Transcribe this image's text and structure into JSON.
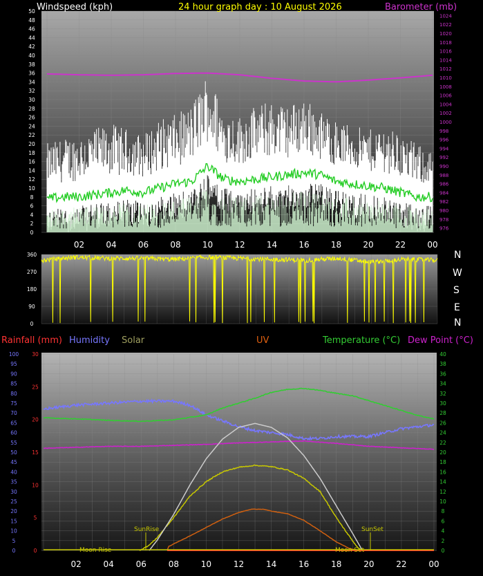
{
  "header": {
    "left": "Windspeed (kph)",
    "center": "24 hour graph day : 10 August 2026",
    "right": "Barometer (mb)"
  },
  "compass": [
    "N",
    "W",
    "S",
    "E",
    "N"
  ],
  "legend": {
    "rainfall": "Rainfall (mm)",
    "humidity": "Humidity",
    "solar": "Solar",
    "uv": "UV",
    "temperature": "Temperature (°C)",
    "dew_point": "Dew Point (°C)"
  },
  "colors": {
    "windspeed": "#ffffff",
    "gust_fill": "#ccf0cc",
    "wind_avg": "#22cc22",
    "barometer": "#cc33cc",
    "direction": "#ffff00",
    "rainfall": "#ff3333",
    "humidity": "#7777ff",
    "solar": "#c8c800",
    "solar_max": "#cccccc",
    "uv": "#d06010",
    "temperature": "#33cc33",
    "dew_point": "#cc22cc",
    "sunrise_label": "#c8c800",
    "moon_label": "#c8c800"
  },
  "annotations": {
    "sunrise": "SunRise",
    "sunset": "SunSet",
    "moon_rise": "Moon Rise",
    "moon_set": "Moon Set"
  },
  "chart_data": [
    {
      "type": "line",
      "title": "24 hour graph day : 10 August 2026",
      "x_unit": "hour of day",
      "x_ticks": [
        "02",
        "04",
        "06",
        "08",
        "10",
        "12",
        "14",
        "16",
        "18",
        "20",
        "22",
        "00"
      ],
      "grid": true,
      "axes": {
        "windspeed": {
          "label": "Windspeed (kph)",
          "range": [
            0,
            50
          ],
          "ticks": [
            0,
            2,
            4,
            6,
            8,
            10,
            12,
            14,
            16,
            18,
            20,
            22,
            24,
            26,
            28,
            30,
            32,
            34,
            36,
            38,
            40,
            42,
            44,
            46,
            48,
            50
          ]
        },
        "barometer": {
          "label": "Barometer (mb)",
          "range": [
            975,
            1025
          ],
          "ticks": [
            976,
            978,
            980,
            982,
            984,
            986,
            988,
            990,
            992,
            994,
            996,
            998,
            1000,
            1002,
            1004,
            1006,
            1008,
            1010,
            1012,
            1014,
            1016,
            1018,
            1020,
            1022,
            1024
          ]
        }
      },
      "series": [
        {
          "name": "Barometer (mb)",
          "axis": "barometer",
          "x": [
            0,
            2,
            4,
            6,
            8,
            10,
            12,
            14,
            16,
            18,
            20,
            22,
            24
          ],
          "values": [
            1010.8,
            1010.6,
            1010.5,
            1010.6,
            1010.9,
            1011.0,
            1010.6,
            1009.8,
            1009.2,
            1009.0,
            1009.4,
            1009.9,
            1010.5
          ]
        },
        {
          "name": "Wind average (kph)",
          "axis": "windspeed",
          "x": [
            0,
            1,
            2,
            3,
            4,
            5,
            6,
            7,
            8,
            9,
            10,
            11,
            12,
            13,
            14,
            15,
            16,
            17,
            18,
            19,
            20,
            21,
            22,
            23,
            24
          ],
          "values": [
            7.5,
            8,
            8,
            8.5,
            9,
            9.5,
            9,
            10,
            11,
            11.5,
            15,
            12,
            11.5,
            12,
            12.5,
            13,
            13.5,
            13,
            11.5,
            11,
            10.5,
            10,
            9,
            8,
            8
          ]
        },
        {
          "name": "Wind gust (kph)",
          "axis": "windspeed",
          "x": [
            0,
            1,
            2,
            3,
            4,
            5,
            6,
            7,
            8,
            9,
            10,
            11,
            12,
            13,
            14,
            15,
            16,
            17,
            18,
            19,
            20,
            21,
            22,
            23,
            24
          ],
          "values": [
            18,
            19,
            20,
            21,
            22,
            21,
            20,
            23,
            24,
            26,
            33,
            25,
            24,
            26,
            27,
            26,
            28,
            25,
            23,
            22,
            21,
            22,
            20,
            18,
            17
          ]
        }
      ]
    },
    {
      "type": "scatter",
      "title": "Wind direction",
      "x_unit": "hour of day",
      "y_range": [
        0,
        360
      ],
      "y_ticks": [
        0,
        90,
        180,
        270,
        360
      ],
      "series": [
        {
          "name": "Direction (deg)",
          "x": [
            0,
            2,
            4,
            6,
            8,
            10,
            12,
            14,
            16,
            18,
            20,
            22,
            24
          ],
          "values": [
            330,
            345,
            340,
            340,
            335,
            345,
            340,
            335,
            330,
            340,
            320,
            335,
            330
          ]
        }
      ]
    },
    {
      "type": "line",
      "title": "",
      "x_unit": "hour of day",
      "x_ticks": [
        "02",
        "04",
        "06",
        "08",
        "10",
        "12",
        "14",
        "16",
        "18",
        "20",
        "22",
        "00"
      ],
      "grid": true,
      "axes": {
        "humidity": {
          "label": "Humidity",
          "range": [
            0,
            100
          ],
          "ticks": [
            0,
            5,
            10,
            15,
            20,
            25,
            30,
            35,
            40,
            45,
            50,
            55,
            60,
            65,
            70,
            75,
            80,
            85,
            90,
            95,
            100
          ]
        },
        "rain_uv": {
          "label": "Rainfall (mm)",
          "range": [
            0,
            30
          ],
          "ticks": [
            0,
            5,
            10,
            15,
            20,
            25,
            30
          ]
        },
        "temperature": {
          "label": "Temperature (°C)",
          "range": [
            0,
            40
          ],
          "ticks": [
            0,
            2,
            4,
            6,
            8,
            10,
            12,
            14,
            16,
            18,
            20,
            22,
            24,
            26,
            28,
            30,
            32,
            34,
            36,
            38,
            40
          ]
        }
      },
      "series": [
        {
          "name": "Humidity",
          "axis": "humidity",
          "x": [
            0,
            2,
            4,
            6,
            8,
            9,
            10,
            11,
            12,
            13,
            14,
            15,
            16,
            17,
            18,
            19,
            20,
            21,
            22,
            23,
            24
          ],
          "values": [
            72,
            74,
            75,
            76,
            76,
            74,
            69,
            66,
            63,
            61,
            60,
            59,
            57,
            57,
            58,
            58,
            58,
            60,
            62,
            63,
            64
          ]
        },
        {
          "name": "Temperature (°C)",
          "axis": "temperature",
          "x": [
            0,
            2,
            4,
            6,
            8,
            10,
            11,
            12,
            13,
            14,
            15,
            16,
            17,
            18,
            19,
            20,
            21,
            22,
            23,
            24
          ],
          "values": [
            27,
            26.8,
            26.5,
            26.3,
            26.6,
            27.6,
            29,
            30,
            31,
            32.2,
            32.8,
            33,
            32.6,
            32,
            31.5,
            30.5,
            29.5,
            28.5,
            27.5,
            26.8
          ]
        },
        {
          "name": "Dew Point (°C)",
          "axis": "temperature",
          "x": [
            0,
            2,
            4,
            6,
            8,
            10,
            12,
            14,
            16,
            18,
            20,
            22,
            24
          ],
          "values": [
            20.8,
            21,
            21.2,
            21.2,
            21.4,
            21.6,
            21.9,
            22.1,
            22.3,
            21.8,
            21.2,
            20.9,
            20.6
          ]
        },
        {
          "name": "Solar",
          "axis": "rain_uv",
          "x": [
            5.9,
            6.5,
            7,
            8,
            9,
            10,
            11,
            12,
            13,
            14,
            15,
            16,
            17,
            18,
            18.7,
            19.2,
            19.5
          ],
          "values": [
            0,
            0.8,
            2,
            5,
            8.3,
            10.5,
            12,
            12.7,
            13,
            12.8,
            12.3,
            11,
            9,
            5,
            2.5,
            0.8,
            0
          ]
        },
        {
          "name": "Solar max",
          "axis": "rain_uv",
          "x": [
            6.5,
            7,
            8,
            9,
            10,
            11,
            12,
            13,
            14,
            15,
            16,
            17,
            18,
            19,
            19.6
          ],
          "values": [
            0,
            1.6,
            5.5,
            10,
            14,
            17,
            18.8,
            19.4,
            18.8,
            17.2,
            14.5,
            11,
            6.8,
            2.6,
            0
          ]
        },
        {
          "name": "UV",
          "axis": "rain_uv",
          "x": [
            7.6,
            7.7,
            8,
            9,
            10,
            11,
            12,
            12.8,
            13.5,
            14,
            15,
            16,
            17,
            18,
            18.8,
            19.3
          ],
          "values": [
            0,
            0.6,
            1,
            2.2,
            3.5,
            4.8,
            5.8,
            6.3,
            6.3,
            6,
            5.6,
            4.6,
            3,
            1.3,
            0.3,
            0
          ]
        },
        {
          "name": "Rainfall (mm)",
          "axis": "rain_uv",
          "x": [
            7.6,
            24
          ],
          "values": [
            0,
            0
          ]
        }
      ]
    }
  ]
}
